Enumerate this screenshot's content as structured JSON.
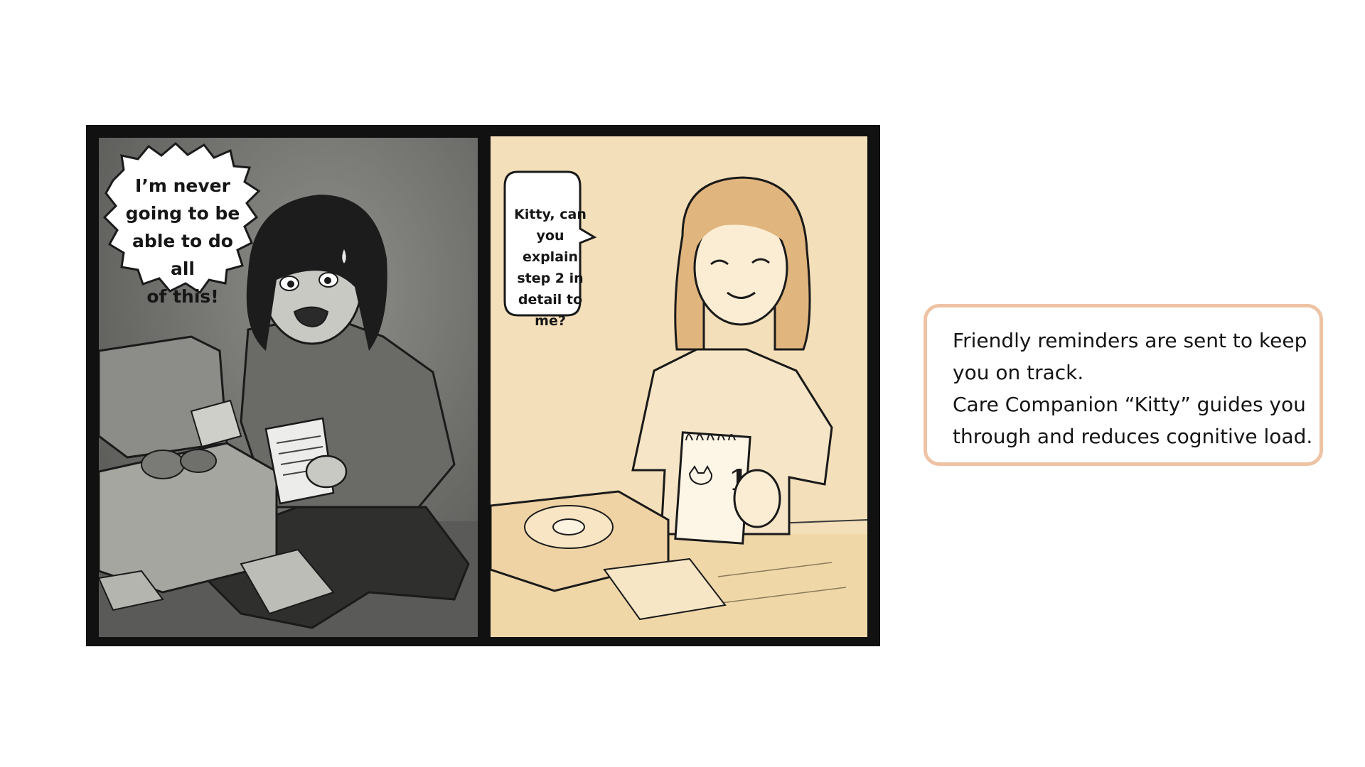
{
  "comic": {
    "panel_left": {
      "speech_lines": [
        "I’m never",
        "going to be",
        "able to do all",
        "of this!"
      ]
    },
    "panel_right": {
      "speech_lines": [
        "Kitty, can",
        "you",
        "explain",
        "step 2 in",
        "detail to",
        "me?"
      ],
      "calendar_number": "1"
    }
  },
  "caption": {
    "lines": [
      "Friendly reminders are sent to keep",
      "you on track.",
      "Care Companion “Kitty” guides you",
      "through and reduces cognitive load."
    ]
  },
  "colors": {
    "frame": "#111111",
    "left_panel_bg": "#5e5e5b",
    "right_panel_bg": "#f3dfb9",
    "caption_border": "#eec3a4"
  }
}
